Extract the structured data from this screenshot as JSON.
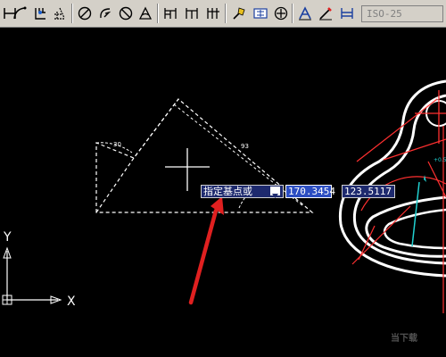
{
  "toolbar": {
    "dimstyle_value": "ISO-25",
    "tools": [
      "linear-dim-icon",
      "arc-length-icon",
      "ordinate-dim-icon",
      "radius-dim-icon",
      "jogged-dim-icon",
      "diameter-dim-icon",
      "angular-dim-icon",
      "quick-dim-icon",
      "baseline-dim-icon",
      "continue-dim-icon",
      "leader-icon",
      "tolerance-icon",
      "center-mark-icon",
      "dim-edit-icon",
      "dim-text-edit-icon",
      "dim-update-icon"
    ]
  },
  "canvas": {
    "background": "#000000",
    "prompt_text": "指定基点或",
    "x_value": "170.3454",
    "y_value": "123.5117",
    "ucs_x_label": "X",
    "ucs_y_label": "Y",
    "annotation_arrow_color": "#e02020"
  },
  "watermark": {
    "text": "当下载"
  }
}
